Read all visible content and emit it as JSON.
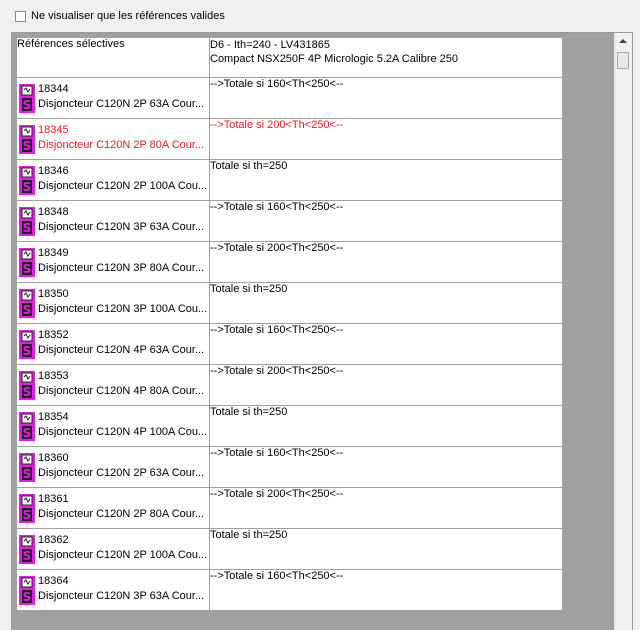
{
  "filter": {
    "label": "Ne visualiser que les références valides",
    "checked": false
  },
  "table": {
    "header_ref": "Références sélectives",
    "header_device_line1": "D6 - Ith=240 - LV431865",
    "header_device_line2": "Compact NSX250F 4P Micrologic 5.2A Calibre 250",
    "rows": [
      {
        "code": "18344",
        "desc": "Disjoncteur C120N 2P 63A Cour...",
        "cond": "-->Totale si 160<Th<250<--",
        "highlight": false
      },
      {
        "code": "18345",
        "desc": "Disjoncteur C120N 2P 80A Cour...",
        "cond": "-->Totale si 200<Th<250<--",
        "highlight": true
      },
      {
        "code": "18346",
        "desc": "Disjoncteur C120N 2P 100A Cou...",
        "cond": "Totale si th=250",
        "highlight": false
      },
      {
        "code": "18348",
        "desc": "Disjoncteur C120N 3P 63A Cour...",
        "cond": "-->Totale si 160<Th<250<--",
        "highlight": false
      },
      {
        "code": "18349",
        "desc": "Disjoncteur C120N 3P 80A Cour...",
        "cond": "-->Totale si 200<Th<250<--",
        "highlight": false
      },
      {
        "code": "18350",
        "desc": "Disjoncteur C120N 3P 100A Cou...",
        "cond": "Totale si th=250",
        "highlight": false
      },
      {
        "code": "18352",
        "desc": "Disjoncteur C120N 4P 63A Cour...",
        "cond": "-->Totale si 160<Th<250<--",
        "highlight": false
      },
      {
        "code": "18353",
        "desc": "Disjoncteur C120N 4P 80A Cour...",
        "cond": "-->Totale si 200<Th<250<--",
        "highlight": false
      },
      {
        "code": "18354",
        "desc": "Disjoncteur C120N 4P 100A Cou...",
        "cond": "Totale si th=250",
        "highlight": false
      },
      {
        "code": "18360",
        "desc": "Disjoncteur C120N 2P 63A Cour...",
        "cond": "-->Totale si 160<Th<250<--",
        "highlight": false
      },
      {
        "code": "18361",
        "desc": "Disjoncteur C120N 2P 80A Cour...",
        "cond": "-->Totale si 200<Th<250<--",
        "highlight": false
      },
      {
        "code": "18362",
        "desc": "Disjoncteur C120N 2P 100A Cou...",
        "cond": "Totale si th=250",
        "highlight": false
      },
      {
        "code": "18364",
        "desc": "Disjoncteur C120N 3P 63A Cour...",
        "cond": "-->Totale si 160<Th<250<--",
        "highlight": false
      }
    ]
  },
  "colors": {
    "icon_bg": "#e020e0",
    "highlight_text": "#e02020",
    "gutter": "#a0a0a0"
  },
  "icon_name": "breaker-product-icon"
}
